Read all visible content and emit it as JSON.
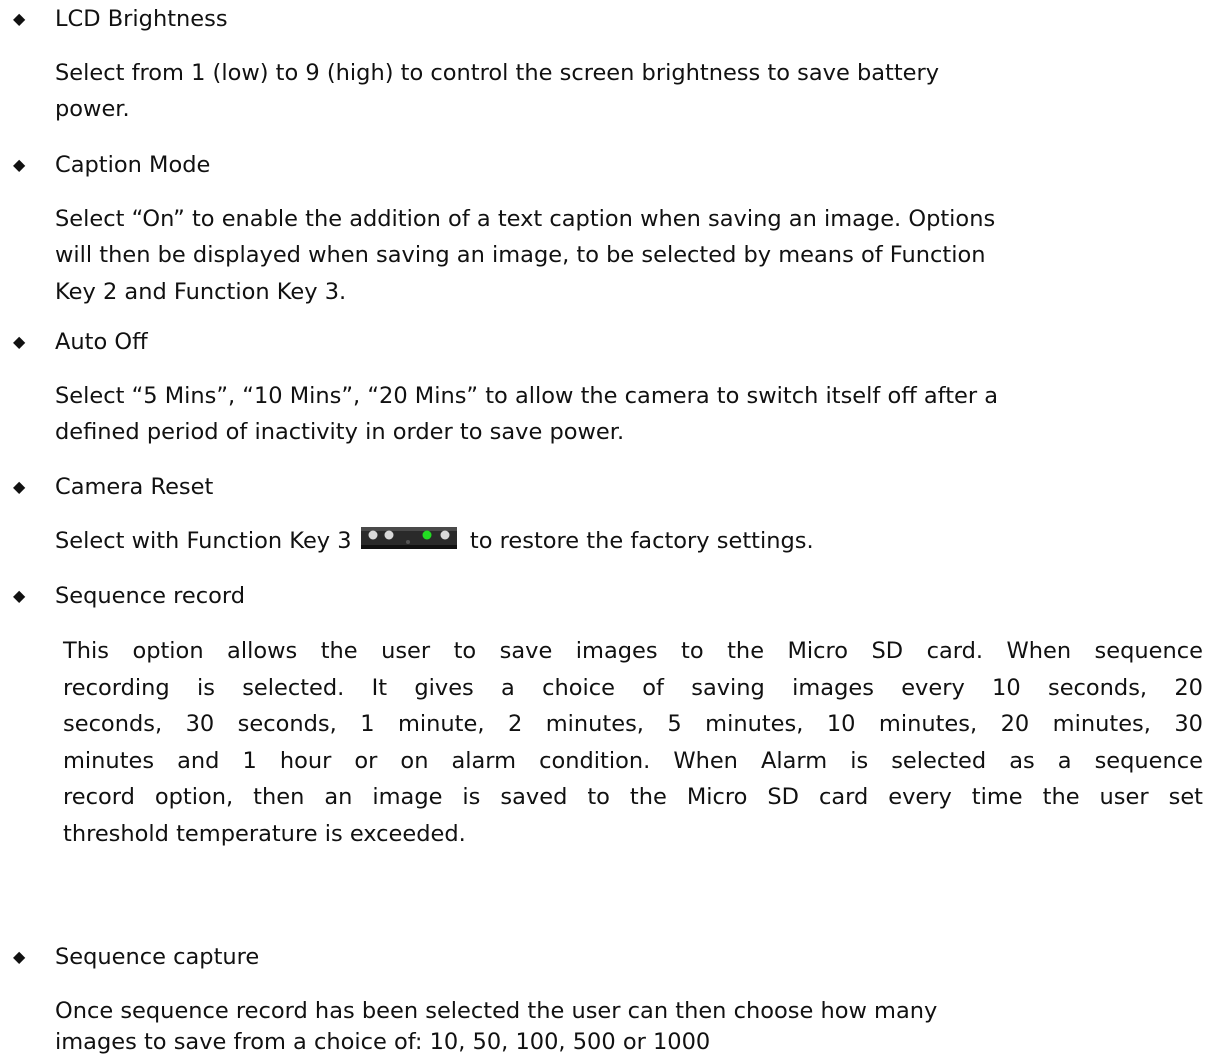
{
  "items": [
    {
      "heading": "LCD Brightness",
      "lines": [
        "Select from 1 (low) to 9 (high) to control the screen brightness to save battery",
        "power."
      ]
    },
    {
      "heading": "Caption Mode",
      "lines": [
        "Select “On” to enable the addition of a text caption when saving an image.  Options",
        "will then be displayed when saving an image, to be selected by means of Function",
        "Key 2 and Function Key 3."
      ]
    },
    {
      "heading": "Auto Off",
      "lines": [
        "Select “5 Mins”, “10 Mins”, “20 Mins” to allow the camera to switch itself off after a",
        "defined period of inactivity in order to save power."
      ]
    },
    {
      "heading": "Camera Reset",
      "line_before_icon": "Select with Function Key 3",
      "line_after_icon": "to restore the factory settings.",
      "icon": "function-key-3-icon"
    },
    {
      "heading": "Sequence record",
      "lines": [
        "This option allows the user to save images to the Micro SD card. When sequence",
        "recording is selected. It gives a choice of saving images every 10 seconds, 20",
        "seconds, 30 seconds, 1 minute, 2 minutes, 5 minutes, 10 minutes, 20 minutes, 30",
        "minutes and 1 hour or on alarm condition. When Alarm is selected as a sequence",
        "record option, then an image is saved to the Micro SD card every time the user set",
        "threshold temperature is exceeded."
      ]
    },
    {
      "heading": "Sequence capture",
      "lines": [
        "Once sequence record has been selected the user can then choose how many",
        "images to save from a choice of: 10, 50, 100, 500 or 1000"
      ]
    }
  ],
  "bullet_glyph": "◆",
  "colors": {
    "text": "#111111",
    "key_body": "#2a2a2a",
    "key_led_off": "#d9d9d9",
    "key_led_on": "#22dd22"
  }
}
